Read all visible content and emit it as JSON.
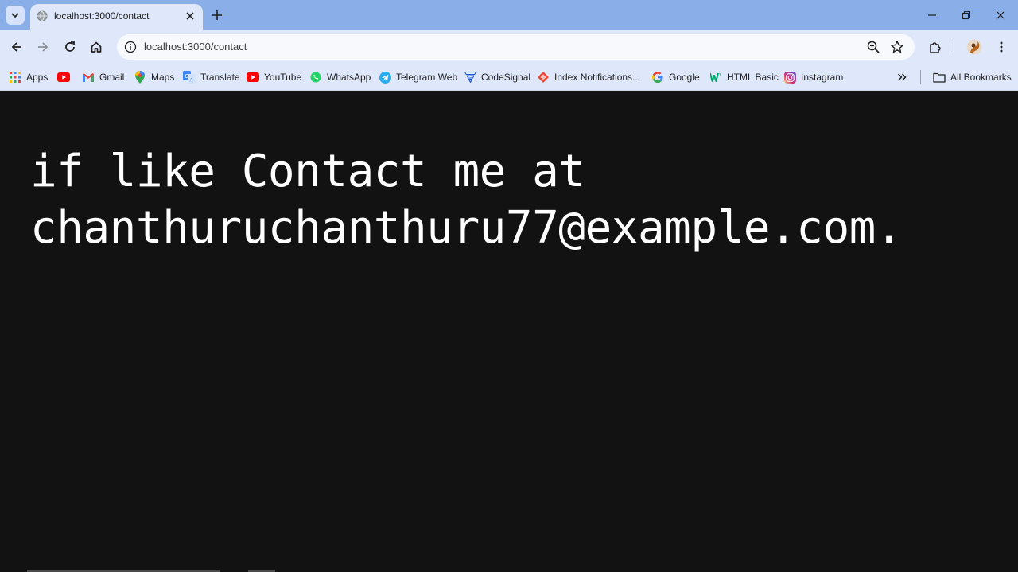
{
  "browser": {
    "tab": {
      "title": "localhost:3000/contact"
    },
    "address_bar": {
      "url": "localhost:3000/contact"
    },
    "bookmarks": [
      {
        "label": "Apps",
        "icon": "apps-grid-icon"
      },
      {
        "label": "",
        "icon": "youtube-icon"
      },
      {
        "label": "Gmail",
        "icon": "gmail-icon"
      },
      {
        "label": "Maps",
        "icon": "maps-icon"
      },
      {
        "label": "Translate",
        "icon": "translate-icon"
      },
      {
        "label": "YouTube",
        "icon": "youtube-icon"
      },
      {
        "label": "WhatsApp",
        "icon": "whatsapp-icon"
      },
      {
        "label": "Telegram Web",
        "icon": "telegram-icon"
      },
      {
        "label": "CodeSignal",
        "icon": "codesignal-icon"
      },
      {
        "label": "Index Notifications...",
        "icon": "index-icon"
      },
      {
        "label": "Google",
        "icon": "google-icon"
      },
      {
        "label": "HTML Basic",
        "icon": "w3schools-icon"
      },
      {
        "label": "Instagram",
        "icon": "instagram-icon"
      }
    ],
    "all_bookmarks_label": "All Bookmarks"
  },
  "page": {
    "line1": "if like Contact me at",
    "line2": "chanthuruchanthuru77@example.com."
  },
  "colors": {
    "tabstrip": "#89aee8",
    "toolbar": "#dfe8fb",
    "page_background": "#121212",
    "page_text": "#ffffff"
  }
}
